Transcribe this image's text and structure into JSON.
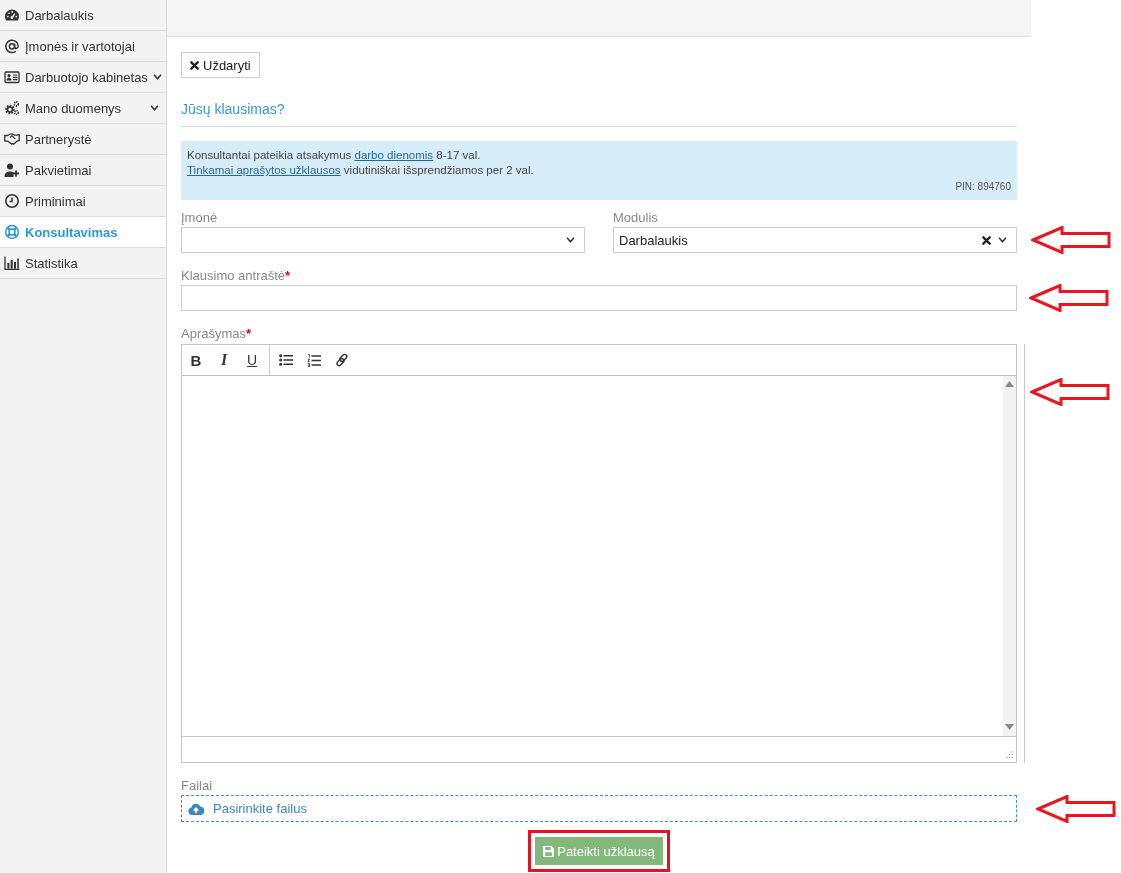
{
  "sidebar": {
    "items": [
      {
        "label": "Darbalaukis",
        "selected": false,
        "submenu": false
      },
      {
        "label": "Įmonės ir vartotojai",
        "selected": false,
        "submenu": false
      },
      {
        "label": "Darbuotojo kabinetas",
        "selected": false,
        "submenu": true
      },
      {
        "label": "Mano duomenys",
        "selected": false,
        "submenu": true
      },
      {
        "label": "Partnerystė",
        "selected": false,
        "submenu": false
      },
      {
        "label": "Pakvietimai",
        "selected": false,
        "submenu": false
      },
      {
        "label": "Priminimai",
        "selected": false,
        "submenu": false
      },
      {
        "label": "Konsultavimas",
        "selected": true,
        "submenu": false
      },
      {
        "label": "Statistika",
        "selected": false,
        "submenu": false
      }
    ]
  },
  "close_button": {
    "label": "Uždaryti"
  },
  "heading": "Jūsų klausimas?",
  "notice": {
    "lines": [
      [
        {
          "text": "Konsultantai pateikia atsakymus ",
          "link": false
        },
        {
          "text": "darbo dienomis",
          "link": true
        },
        {
          "text": " 8-17 val.",
          "link": false
        }
      ],
      [
        {
          "text": "Tinkamai aprašytos užklausos",
          "link": true
        },
        {
          "text": " vidutiniškai išsprendžiamos per 2 val.",
          "link": false
        }
      ]
    ],
    "pin": "PIN: 894760"
  },
  "company_select": {
    "label": "Įmonė",
    "annotated": false
  },
  "module_select": {
    "label": "Modulis",
    "value": "Darbalaukis",
    "clearable": true,
    "annotated": true
  },
  "title_field": {
    "label": "Klausimo antraštė",
    "required_mark": "*",
    "annotated": true
  },
  "description_editor": {
    "label": "Aprašymas",
    "required_mark": "*",
    "annotated": true,
    "toolbar": [
      [
        {
          "kind": "bold",
          "label": "B"
        },
        {
          "kind": "italic",
          "label": "I"
        },
        {
          "kind": "underline",
          "label": "U"
        }
      ],
      [
        {
          "kind": "bulleted-list"
        },
        {
          "kind": "numbered-list"
        },
        {
          "kind": "link"
        }
      ]
    ]
  },
  "files": {
    "label": "Failai",
    "button": "Pasirinkite failus",
    "annotated": true
  },
  "submit_button": {
    "label": "Pateikti užklausą",
    "annotated": true
  }
}
